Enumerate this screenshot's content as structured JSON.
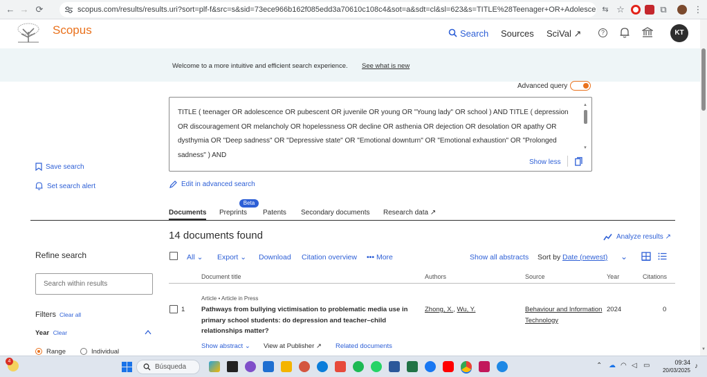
{
  "browser": {
    "url": "scopus.com/results/results.uri?sort=plf-f&src=s&sid=73ece966b162f085edd3a70610c108c4&sot=a&sdt=cl&sl=623&s=TITLE%28Teenager+OR+Adolescence+OR+Pubescent..."
  },
  "header": {
    "logo": "Scopus",
    "nav": {
      "search": "Search",
      "sources": "Sources",
      "scival": "SciVal ↗"
    },
    "avatar": "KT"
  },
  "banner": {
    "text": "Welcome to a more intuitive and efficient search experience.",
    "link": "See what is new"
  },
  "advanced_query": {
    "label": "Advanced query"
  },
  "query": {
    "text": "TITLE ( teenager OR adolescence OR pubescent OR juvenile OR young OR \"Young lady\" OR school ) AND TITLE ( depression OR discouragement OR melancholy OR hopelessness OR decline OR asthenia OR dejection OR desolation OR apathy OR dysthymia OR \"Deep sadness\" OR \"Depressive state\" OR \"Emotional downturn\" OR \"Emotional exhaustion\" OR \"Prolonged sadness\" ) AND",
    "show_less": "Show less"
  },
  "sidebar": {
    "save_search": "Save search",
    "set_alert": "Set search alert",
    "refine": "Refine search",
    "search_within_placeholder": "Search within results",
    "filters": "Filters",
    "clear_all": "Clear all",
    "year": "Year",
    "clear": "Clear",
    "range": "Range",
    "individual": "Individual"
  },
  "edit_advanced": "Edit in advanced search",
  "tabs": {
    "documents": "Documents",
    "preprints": "Preprints",
    "beta": "Beta",
    "patents": "Patents",
    "secondary": "Secondary documents",
    "research": "Research data ↗"
  },
  "results": {
    "count_text": "14 documents found",
    "analyze": "Analyze results ↗",
    "toolbar": {
      "all": "All",
      "export": "Export",
      "download": "Download",
      "citation": "Citation overview",
      "more": "More",
      "show_abstracts": "Show all abstracts",
      "sort_by": "Sort by",
      "sort_value": "Date (newest)"
    },
    "columns": {
      "title": "Document title",
      "authors": "Authors",
      "source": "Source",
      "year": "Year",
      "citations": "Citations"
    },
    "rows": [
      {
        "num": "1",
        "type": "Article • Article in Press",
        "title": "Pathways from bullying victimisation to problematic media use in primary school students: do depression and teacher–child relationships matter?",
        "author1": "Zhong, X.",
        "author2": "Wu, Y.",
        "source": "Behaviour and Information Technology",
        "year": "2024",
        "citations": "0",
        "show_abstract": "Show abstract",
        "view_publisher": "View at Publisher ↗",
        "related": "Related documents"
      }
    ]
  },
  "taskbar": {
    "search": "Búsqueda",
    "time": "09:34",
    "date": "20/03/2025",
    "badge": "4"
  }
}
